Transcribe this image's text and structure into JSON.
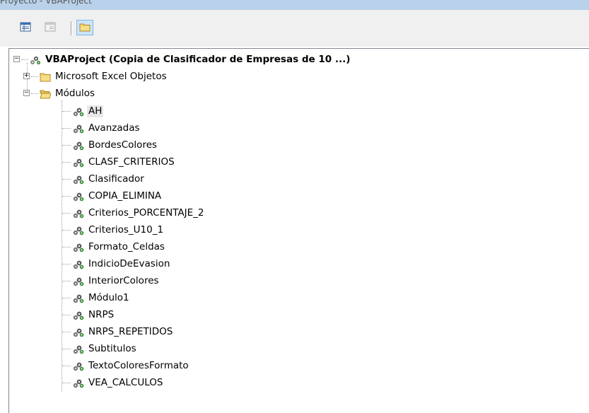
{
  "window": {
    "title": "Proyecto - VBAProject"
  },
  "toolbar": {
    "buttons": [
      {
        "name": "view-code",
        "icon": "view-code-icon"
      },
      {
        "name": "view-object",
        "icon": "view-object-icon"
      },
      {
        "name": "toggle-folders",
        "icon": "folder-icon",
        "pressed": true
      }
    ]
  },
  "tree": {
    "root": {
      "label": "VBAProject (Copia de Clasificador de Empresas de 10 ...)",
      "expanded": true
    },
    "folders": [
      {
        "label": "Microsoft Excel Objetos",
        "expanded": false
      },
      {
        "label": "Módulos",
        "expanded": true
      }
    ],
    "modules": [
      {
        "label": "AH",
        "selected": true
      },
      {
        "label": "Avanzadas"
      },
      {
        "label": "BordesColores"
      },
      {
        "label": "CLASF_CRITERIOS"
      },
      {
        "label": "Clasificador"
      },
      {
        "label": "COPIA_ELIMINA"
      },
      {
        "label": "Criterios_PORCENTAJE_2"
      },
      {
        "label": "Criterios_U10_1"
      },
      {
        "label": "Formato_Celdas"
      },
      {
        "label": "IndicioDeEvasion"
      },
      {
        "label": "InteriorColores"
      },
      {
        "label": "Módulo1"
      },
      {
        "label": "NRPS"
      },
      {
        "label": "NRPS_REPETIDOS"
      },
      {
        "label": "Subtitulos"
      },
      {
        "label": "TextoColoresFormato"
      },
      {
        "label": "VEA_CALCULOS"
      }
    ]
  },
  "colors": {
    "title_bar": "#b9d1ea",
    "toolbar_bg": "#f0f0f0",
    "selection_bg": "#e8e8e8",
    "folder_yellow": "#f4d46a",
    "pressed_border": "#7eb4ea"
  }
}
